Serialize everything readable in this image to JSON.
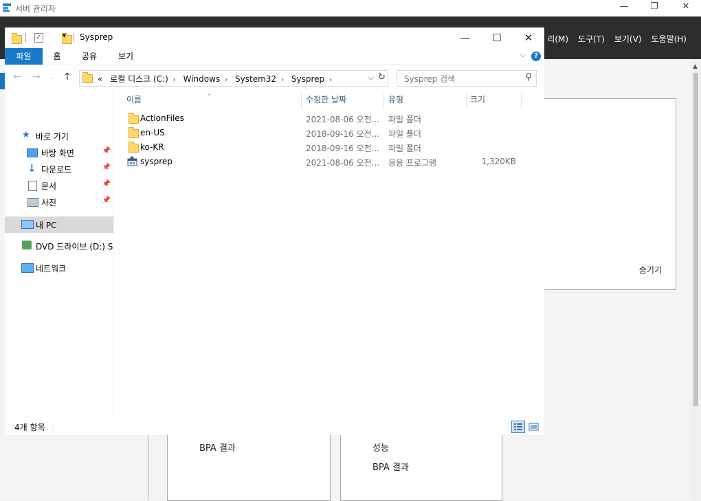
{
  "server_manager": {
    "title": "서버 관리자",
    "menu": [
      "리(M)",
      "도구(T)",
      "보기(V)",
      "도움말(H)"
    ],
    "tile_hide": "숨기기",
    "panel_left_line1": "BPA 결과",
    "panel_right_line1": "성능",
    "panel_right_line2": "BPA 결과"
  },
  "explorer": {
    "title": "Sysprep",
    "ribbon_tabs": [
      "파일",
      "홈",
      "공유",
      "보기"
    ],
    "address": {
      "crumbs": [
        "«",
        "로컬 디스크 (C:)",
        "Windows",
        "System32",
        "Sysprep"
      ]
    },
    "search": {
      "placeholder": "Sysprep 검색"
    },
    "nav": {
      "quick_access": "바로 가기",
      "desktop": "바탕 화면",
      "downloads": "다운로드",
      "documents": "문서",
      "pictures": "사진",
      "this_pc": "내 PC",
      "dvd": "DVD 드라이브 (D:) S",
      "network": "네트워크"
    },
    "columns": {
      "name": "이름",
      "modified": "수정한 날짜",
      "type": "유형",
      "size": "크기"
    },
    "files": [
      {
        "name": "ActionFiles",
        "modified": "2021-08-06 오전...",
        "type": "파일 폴더",
        "size": "",
        "icon": "folder-icon"
      },
      {
        "name": "en-US",
        "modified": "2018-09-16 오전...",
        "type": "파일 폴더",
        "size": "",
        "icon": "folder-icon"
      },
      {
        "name": "ko-KR",
        "modified": "2018-09-16 오전...",
        "type": "파일 폴더",
        "size": "",
        "icon": "folder-icon"
      },
      {
        "name": "sysprep",
        "modified": "2021-08-06 오전...",
        "type": "응용 프로그램",
        "size": "1,320KB",
        "icon": "application-icon"
      }
    ],
    "status": {
      "item_count": "4개 항목"
    }
  }
}
